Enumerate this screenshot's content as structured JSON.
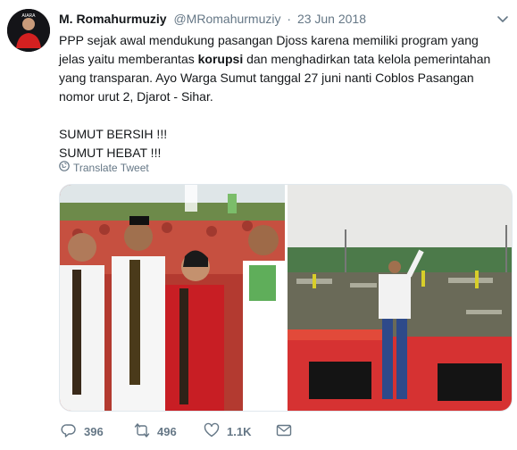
{
  "tweet": {
    "name": "M. Romahurmuziy",
    "handle": "@MRomahurmuziy",
    "separator": "·",
    "date": "23 Jun 2018",
    "body": {
      "p1_before": "PPP sejak awal mendukung pasangan Djoss karena memiliki program yang jelas yaitu memberantas ",
      "p1_bold": "korupsi",
      "p1_after": " dan menghadirkan tata kelola pemerintahan yang transparan. Ayo Warga Sumut tanggal 27 juni nanti  Coblos Pasangan nomor urut 2, Djarot - Sihar.",
      "line2": "SUMUT BERSIH !!!",
      "line3": "SUMUT HEBAT !!!"
    },
    "translate_label": "Translate Tweet",
    "avatar_caption": "AIARA",
    "icons": {
      "more": "chevron-down-icon",
      "translate": "globe-icon",
      "reply": "reply-icon",
      "retweet": "retweet-icon",
      "like": "heart-icon",
      "dm": "envelope-icon"
    },
    "stats": {
      "replies": "396",
      "retweets": "496",
      "likes": "1.1K"
    },
    "colors": {
      "text": "#14171a",
      "muted": "#657786",
      "border": "#e1e8ed"
    }
  }
}
